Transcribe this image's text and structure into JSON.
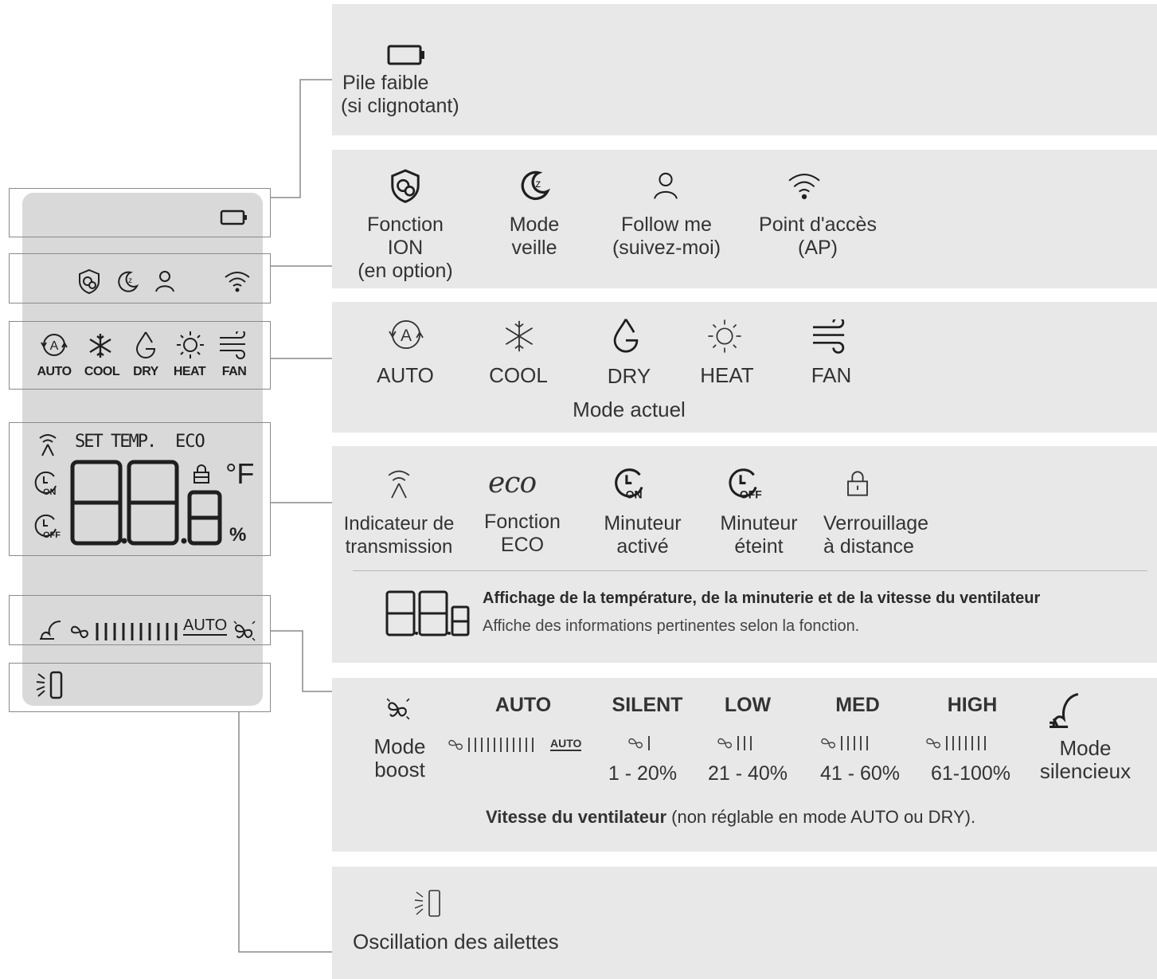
{
  "remote": {
    "modes_row": [
      "AUTO",
      "COOL",
      "DRY",
      "HEAT",
      "FAN"
    ],
    "set_temp": "SET TEMP.",
    "eco": "ECO",
    "unit_f": "°F",
    "percent": "%",
    "fan_auto": "AUTO"
  },
  "battery": {
    "label_line1": "Pile faible",
    "label_line2": "(si clignotant)"
  },
  "functions": [
    {
      "label": "Fonction\nION\n(en option)"
    },
    {
      "label": "Mode\nveille"
    },
    {
      "label": "Follow me\n(suivez-moi)"
    },
    {
      "label": "Point d'accès\n(AP)"
    }
  ],
  "modes": {
    "items": [
      "AUTO",
      "COOL",
      "DRY",
      "HEAT",
      "FAN"
    ],
    "caption": "Mode actuel"
  },
  "indicators": [
    {
      "label": "Indicateur de\ntransmission",
      "icon": "antenna-icon"
    },
    {
      "label": "Fonction\nECO",
      "icon": "eco-icon",
      "glyph": "eco"
    },
    {
      "label": "Minuteur\nactivé",
      "icon": "timer-on-icon"
    },
    {
      "label": "Minuteur\néteint",
      "icon": "timer-off-icon"
    },
    {
      "label": "Verrouillage\nà distance",
      "icon": "lock-icon"
    }
  ],
  "display": {
    "title": "Affichage de la température, de la minuterie et de la vitesse du ventilateur",
    "description": "Affiche des informations pertinentes selon la fonction."
  },
  "fan": {
    "boost_label": "Mode\nboost",
    "auto": "AUTO",
    "auto_badge": "AUTO",
    "speeds": [
      {
        "name": "SILENT",
        "range": "1 - 20%",
        "bars": 1
      },
      {
        "name": "LOW",
        "range": "21 - 40%",
        "bars": 3
      },
      {
        "name": "MED",
        "range": "41 - 60%",
        "bars": 5
      },
      {
        "name": "HIGH",
        "range": "61-100%",
        "bars": 7
      }
    ],
    "silent_label": "Mode\nsilencieux",
    "caption_bold": "Vitesse du ventilateur",
    "caption_rest": " (non réglable en mode AUTO ou DRY)."
  },
  "swing": {
    "label": "Oscillation des ailettes"
  }
}
